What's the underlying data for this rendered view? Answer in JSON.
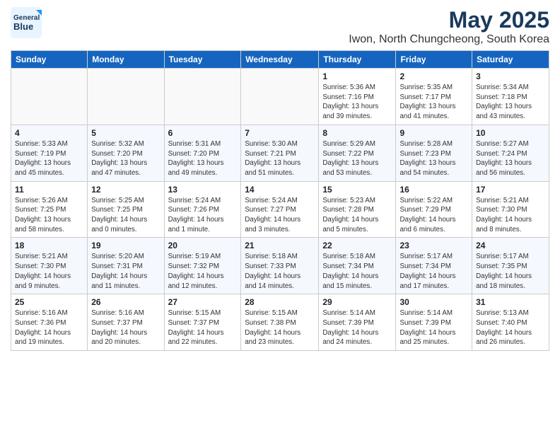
{
  "header": {
    "logo_line1": "General",
    "logo_line2": "Blue",
    "title": "May 2025",
    "subtitle": "Iwon, North Chungcheong, South Korea"
  },
  "weekdays": [
    "Sunday",
    "Monday",
    "Tuesday",
    "Wednesday",
    "Thursday",
    "Friday",
    "Saturday"
  ],
  "weeks": [
    [
      {
        "day": "",
        "info": ""
      },
      {
        "day": "",
        "info": ""
      },
      {
        "day": "",
        "info": ""
      },
      {
        "day": "",
        "info": ""
      },
      {
        "day": "1",
        "info": "Sunrise: 5:36 AM\nSunset: 7:16 PM\nDaylight: 13 hours\nand 39 minutes."
      },
      {
        "day": "2",
        "info": "Sunrise: 5:35 AM\nSunset: 7:17 PM\nDaylight: 13 hours\nand 41 minutes."
      },
      {
        "day": "3",
        "info": "Sunrise: 5:34 AM\nSunset: 7:18 PM\nDaylight: 13 hours\nand 43 minutes."
      }
    ],
    [
      {
        "day": "4",
        "info": "Sunrise: 5:33 AM\nSunset: 7:19 PM\nDaylight: 13 hours\nand 45 minutes."
      },
      {
        "day": "5",
        "info": "Sunrise: 5:32 AM\nSunset: 7:20 PM\nDaylight: 13 hours\nand 47 minutes."
      },
      {
        "day": "6",
        "info": "Sunrise: 5:31 AM\nSunset: 7:20 PM\nDaylight: 13 hours\nand 49 minutes."
      },
      {
        "day": "7",
        "info": "Sunrise: 5:30 AM\nSunset: 7:21 PM\nDaylight: 13 hours\nand 51 minutes."
      },
      {
        "day": "8",
        "info": "Sunrise: 5:29 AM\nSunset: 7:22 PM\nDaylight: 13 hours\nand 53 minutes."
      },
      {
        "day": "9",
        "info": "Sunrise: 5:28 AM\nSunset: 7:23 PM\nDaylight: 13 hours\nand 54 minutes."
      },
      {
        "day": "10",
        "info": "Sunrise: 5:27 AM\nSunset: 7:24 PM\nDaylight: 13 hours\nand 56 minutes."
      }
    ],
    [
      {
        "day": "11",
        "info": "Sunrise: 5:26 AM\nSunset: 7:25 PM\nDaylight: 13 hours\nand 58 minutes."
      },
      {
        "day": "12",
        "info": "Sunrise: 5:25 AM\nSunset: 7:25 PM\nDaylight: 14 hours\nand 0 minutes."
      },
      {
        "day": "13",
        "info": "Sunrise: 5:24 AM\nSunset: 7:26 PM\nDaylight: 14 hours\nand 1 minute."
      },
      {
        "day": "14",
        "info": "Sunrise: 5:24 AM\nSunset: 7:27 PM\nDaylight: 14 hours\nand 3 minutes."
      },
      {
        "day": "15",
        "info": "Sunrise: 5:23 AM\nSunset: 7:28 PM\nDaylight: 14 hours\nand 5 minutes."
      },
      {
        "day": "16",
        "info": "Sunrise: 5:22 AM\nSunset: 7:29 PM\nDaylight: 14 hours\nand 6 minutes."
      },
      {
        "day": "17",
        "info": "Sunrise: 5:21 AM\nSunset: 7:30 PM\nDaylight: 14 hours\nand 8 minutes."
      }
    ],
    [
      {
        "day": "18",
        "info": "Sunrise: 5:21 AM\nSunset: 7:30 PM\nDaylight: 14 hours\nand 9 minutes."
      },
      {
        "day": "19",
        "info": "Sunrise: 5:20 AM\nSunset: 7:31 PM\nDaylight: 14 hours\nand 11 minutes."
      },
      {
        "day": "20",
        "info": "Sunrise: 5:19 AM\nSunset: 7:32 PM\nDaylight: 14 hours\nand 12 minutes."
      },
      {
        "day": "21",
        "info": "Sunrise: 5:18 AM\nSunset: 7:33 PM\nDaylight: 14 hours\nand 14 minutes."
      },
      {
        "day": "22",
        "info": "Sunrise: 5:18 AM\nSunset: 7:34 PM\nDaylight: 14 hours\nand 15 minutes."
      },
      {
        "day": "23",
        "info": "Sunrise: 5:17 AM\nSunset: 7:34 PM\nDaylight: 14 hours\nand 17 minutes."
      },
      {
        "day": "24",
        "info": "Sunrise: 5:17 AM\nSunset: 7:35 PM\nDaylight: 14 hours\nand 18 minutes."
      }
    ],
    [
      {
        "day": "25",
        "info": "Sunrise: 5:16 AM\nSunset: 7:36 PM\nDaylight: 14 hours\nand 19 minutes."
      },
      {
        "day": "26",
        "info": "Sunrise: 5:16 AM\nSunset: 7:37 PM\nDaylight: 14 hours\nand 20 minutes."
      },
      {
        "day": "27",
        "info": "Sunrise: 5:15 AM\nSunset: 7:37 PM\nDaylight: 14 hours\nand 22 minutes."
      },
      {
        "day": "28",
        "info": "Sunrise: 5:15 AM\nSunset: 7:38 PM\nDaylight: 14 hours\nand 23 minutes."
      },
      {
        "day": "29",
        "info": "Sunrise: 5:14 AM\nSunset: 7:39 PM\nDaylight: 14 hours\nand 24 minutes."
      },
      {
        "day": "30",
        "info": "Sunrise: 5:14 AM\nSunset: 7:39 PM\nDaylight: 14 hours\nand 25 minutes."
      },
      {
        "day": "31",
        "info": "Sunrise: 5:13 AM\nSunset: 7:40 PM\nDaylight: 14 hours\nand 26 minutes."
      }
    ]
  ]
}
